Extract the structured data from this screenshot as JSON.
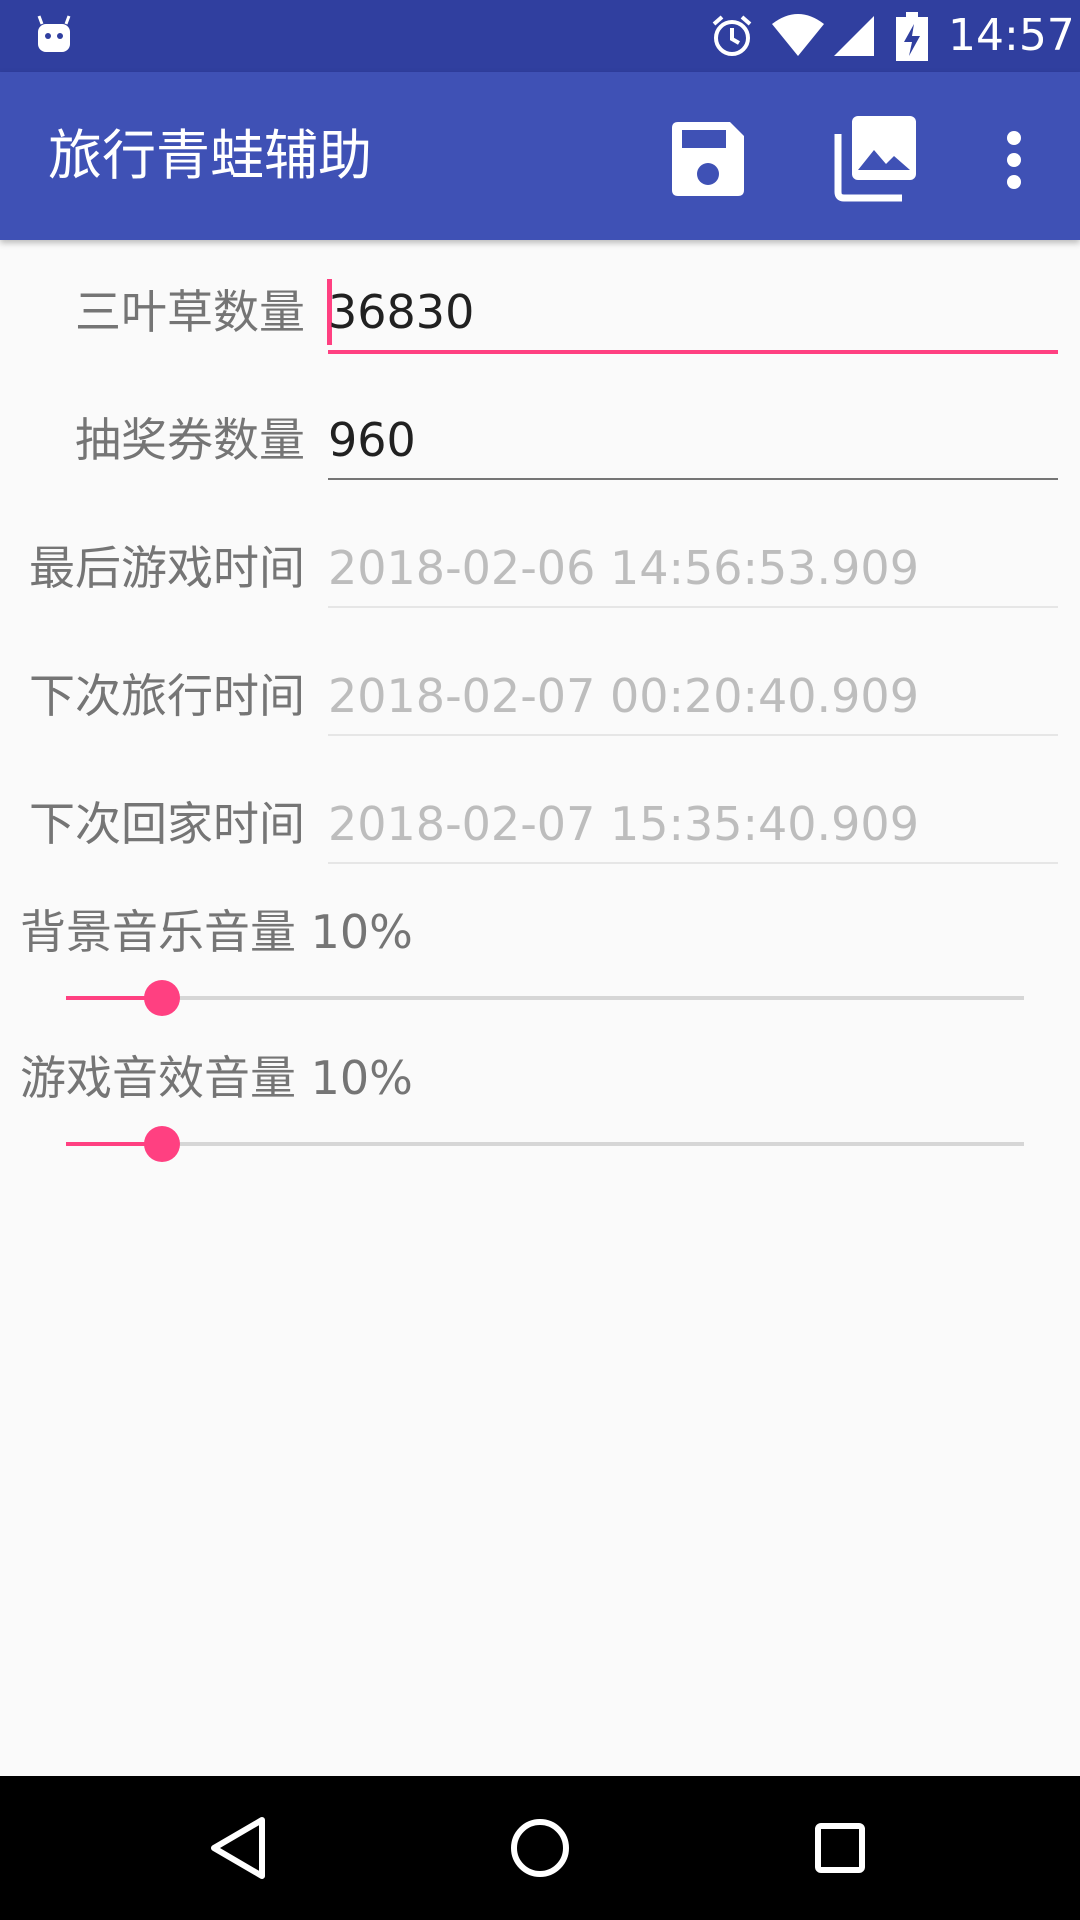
{
  "status_bar": {
    "time": "14:57",
    "icons": [
      "android-icon",
      "alarm-icon",
      "wifi-icon",
      "signal-icon",
      "battery-charging-icon"
    ]
  },
  "app_bar": {
    "title": "旅行青蛙辅助",
    "actions": [
      "save-icon",
      "gallery-icon",
      "more-vert-icon"
    ]
  },
  "form": {
    "clover_label": "三叶草数量",
    "clover_value": "36830",
    "ticket_label": "抽奖券数量",
    "ticket_value": "960",
    "last_play_label": "最后游戏时间",
    "last_play_value": "2018-02-06 14:56:53.909",
    "next_travel_label": "下次旅行时间",
    "next_travel_value": "2018-02-07 00:20:40.909",
    "next_home_label": "下次回家时间",
    "next_home_value": "2018-02-07 15:35:40.909"
  },
  "sliders": {
    "bgm_label": "背景音乐音量 10%",
    "bgm_level": 0.1,
    "sfx_label": "游戏音效音量 10%",
    "sfx_level": 0.1
  },
  "colors": {
    "status_bar": "#303f9f",
    "app_bar": "#3f51b5",
    "accent": "#ff4081",
    "background": "#fafafa"
  },
  "nav_bar": {
    "buttons": [
      "back-icon",
      "home-icon",
      "recents-icon"
    ]
  }
}
